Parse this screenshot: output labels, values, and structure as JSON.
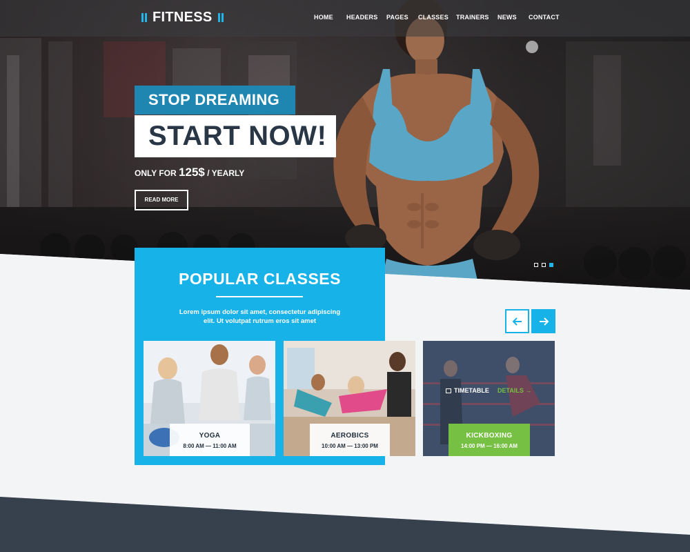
{
  "brand": {
    "name": "FITNESS",
    "accent": "#23b4e9"
  },
  "nav": {
    "items": [
      "HOME",
      "HEADERS",
      "PAGES",
      "CLASSES",
      "TRAINERS",
      "NEWS",
      "CONTACT"
    ]
  },
  "hero": {
    "tagline": "STOP DREAMING",
    "headline": "START NOW!",
    "price_prefix": "ONLY FOR",
    "price_value": "125$",
    "price_suffix": "/ YEARLY",
    "button_label": "READ MORE",
    "slides_total": 3,
    "active_slide": 3
  },
  "popular": {
    "title": "POPULAR CLASSES",
    "description": "Lorem ipsum dolor sit amet, consectetur adipiscing elit. Ut volutpat rutrum eros sit amet",
    "accent": "#17b2e8"
  },
  "classes": [
    {
      "name": "YOGA",
      "time": "8:00 AM — 11:00 AM"
    },
    {
      "name": "AEROBICS",
      "time": "10:00 AM — 13:00 PM"
    },
    {
      "name": "KICKBOXING",
      "time": "14:00 PM — 16:00 AM",
      "timetable_label": "TIMETABLE",
      "details_label": "DETAILS →",
      "highlight_color": "#76c043"
    }
  ],
  "icons": {
    "prev": "arrow-left-icon",
    "next": "arrow-right-icon",
    "timetable": "calendar-icon"
  }
}
